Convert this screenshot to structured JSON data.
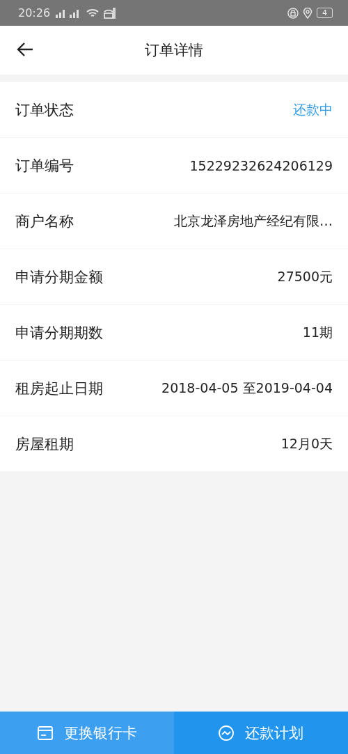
{
  "status_bar": {
    "time": "20:26",
    "battery": "4"
  },
  "header": {
    "title": "订单详情"
  },
  "rows": [
    {
      "label": "订单状态",
      "value": "还款中",
      "kind": "status"
    },
    {
      "label": "订单编号",
      "value": "15229232624206129",
      "kind": "plain"
    },
    {
      "label": "商户名称",
      "value": "北京龙泽房地产经纪有限…",
      "kind": "plain"
    },
    {
      "label": "申请分期金额",
      "value": "27500元",
      "kind": "plain"
    },
    {
      "label": "申请分期期数",
      "value": "11期",
      "kind": "plain"
    },
    {
      "label": "租房起止日期",
      "value": "2018-04-05 至2019-04-04",
      "kind": "plain"
    },
    {
      "label": "房屋租期",
      "value": "12月0天",
      "kind": "plain"
    }
  ],
  "bottom_bar": [
    {
      "label": "更换银行卡",
      "kind": "card",
      "selected": true
    },
    {
      "label": "还款计划",
      "kind": "plan",
      "selected": false
    }
  ]
}
